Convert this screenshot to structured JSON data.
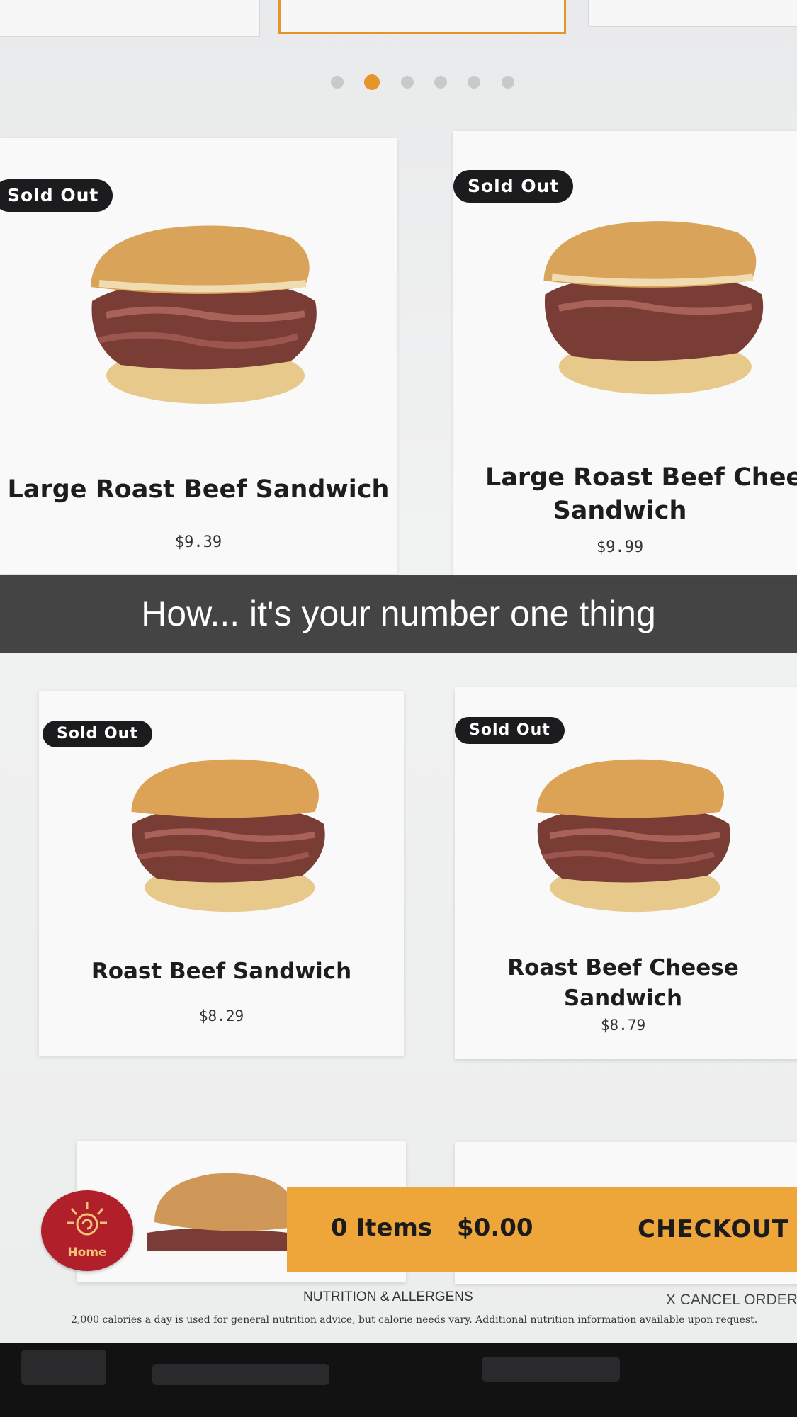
{
  "caption": "How... it's your number one thing",
  "products": [
    {
      "name_line1": "Large Roast Beef Sandwich",
      "name_line2": "",
      "price": "$9.39",
      "badge": "Sold Out"
    },
    {
      "name_line1": "Large Roast Beef Chees",
      "name_line2": "Sandwich",
      "price": "$9.99",
      "badge": "Sold Out"
    },
    {
      "name_line1": "Roast Beef Sandwich",
      "name_line2": "",
      "price": "$8.29",
      "badge": "Sold Out"
    },
    {
      "name_line1": "Roast Beef Cheese",
      "name_line2": "Sandwich",
      "price": "$8.79",
      "badge": "Sold Out"
    }
  ],
  "pagination": {
    "pages": 6,
    "active_index": 1,
    "active_color": "#e6952a"
  },
  "home": {
    "label": "Home"
  },
  "cart": {
    "items_label": "0 Items",
    "total": "$0.00",
    "checkout_label": "CHECKOUT"
  },
  "footer": {
    "nutrition_link": "NUTRITION & ALLERGENS",
    "cancel_link": "X CANCEL ORDER",
    "disclaimer": "2,000 calories a day is used for general nutrition advice, but calorie needs vary. Additional nutrition information available upon request."
  },
  "colors": {
    "accent": "#eea63a",
    "home_red": "#b1202a",
    "badge_bg": "#1c1c1e"
  }
}
